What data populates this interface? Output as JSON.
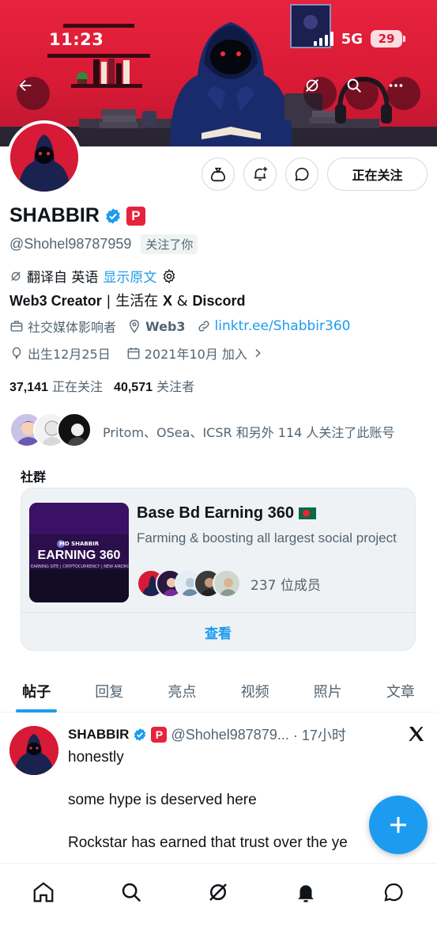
{
  "status_bar": {
    "time": "11:23",
    "network": "5G",
    "battery": "29"
  },
  "profile": {
    "display_name": "SHABBIR",
    "badge_letter": "P",
    "handle": "@Shohel98787959",
    "follows_you": "关注了你",
    "follow_button": "正在关注",
    "translate": {
      "prefix": "翻译自 英语",
      "show_original": "显示原文"
    },
    "bio": {
      "part1": "Web3 Creator",
      "part2": " | 生活在 ",
      "part3": "X",
      "part4": " & ",
      "part5": "Discord"
    },
    "category": "社交媒体影响者",
    "location": "Web3",
    "link": "linktr.ee/Shabbir360",
    "birthday": "出生12月25日",
    "joined": "2021年10月 加入",
    "following_count": "37,141",
    "following_label": "正在关注",
    "followers_count": "40,571",
    "followers_label": "关注者",
    "followed_by_text": "Pritom、OSea、ICSR 和另外 114 人关注了此账号"
  },
  "banner": {
    "logo_text": "MD SHABBIR"
  },
  "community": {
    "section_label": "社群",
    "title": "Base Bd Earning 360",
    "description": "Farming & boosting all largest social project",
    "members": "237 位成员",
    "view_button": "查看",
    "thumb": {
      "brand": "MD SHABBIR",
      "headline": "EARNING 360",
      "sub": "EARNING SITE | CRYPTOCURRENCY | NEW AIRDROP"
    }
  },
  "tabs": [
    "帖子",
    "回复",
    "亮点",
    "视频",
    "照片",
    "文章"
  ],
  "post": {
    "author": "SHABBIR",
    "handle": "@Shohel987879...",
    "time": "· 17小时",
    "lines": [
      "honestly",
      "some hype is deserved here",
      "Rockstar has earned that trust over the ye"
    ]
  },
  "colors": {
    "accent": "#1d9bf0",
    "banner_red": "#d71a35",
    "text": "#0f1419",
    "muted": "#536471"
  }
}
